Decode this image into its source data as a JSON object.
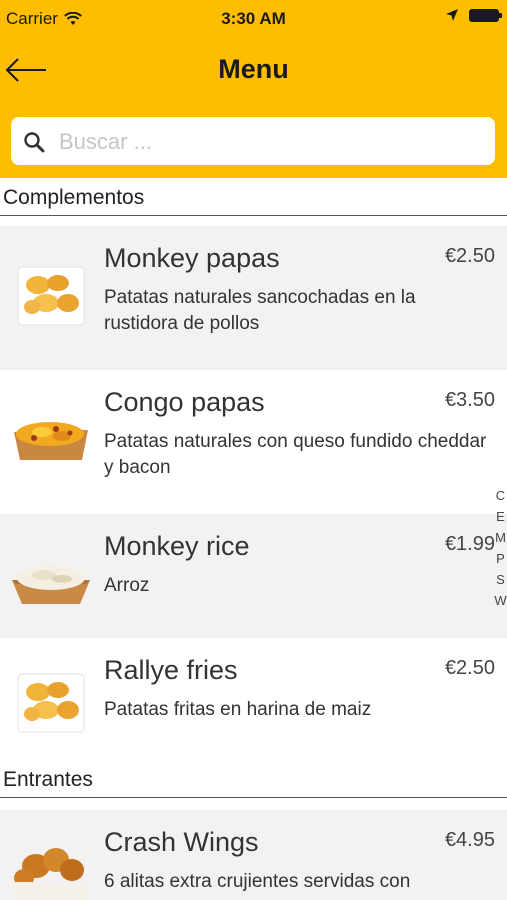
{
  "status_bar": {
    "carrier": "Carrier",
    "time": "3:30 AM"
  },
  "header": {
    "title": "Menu",
    "back_icon": "left-arrow-icon",
    "background": "#ffbd00"
  },
  "search": {
    "placeholder": "Buscar ...",
    "value": ""
  },
  "sections": [
    {
      "title": "Complementos",
      "items": [
        {
          "name": "Monkey papas",
          "price": "€2.50",
          "description": "Patatas naturales sancochadas en la rustidora de pollos",
          "image": "potato-wedges-icon"
        },
        {
          "name": "Congo papas",
          "price": "€3.50",
          "description": "Patatas naturales con queso fundido cheddar y bacon",
          "image": "cheese-fries-icon"
        },
        {
          "name": "Monkey rice",
          "price": "€1.99",
          "description": "Arroz",
          "image": "rice-tray-icon"
        },
        {
          "name": "Rallye fries",
          "price": "€2.50",
          "description": "Patatas fritas en harina de maiz",
          "image": "potato-wedges-icon"
        }
      ]
    },
    {
      "title": "Entrantes",
      "items": [
        {
          "name": "Crash Wings",
          "price": "€4.95",
          "description": "6 alitas extra crujientes servidas con",
          "image": "chicken-bucket-icon"
        }
      ]
    }
  ],
  "section_index": [
    "C",
    "E",
    "M",
    "P",
    "S",
    "W"
  ]
}
